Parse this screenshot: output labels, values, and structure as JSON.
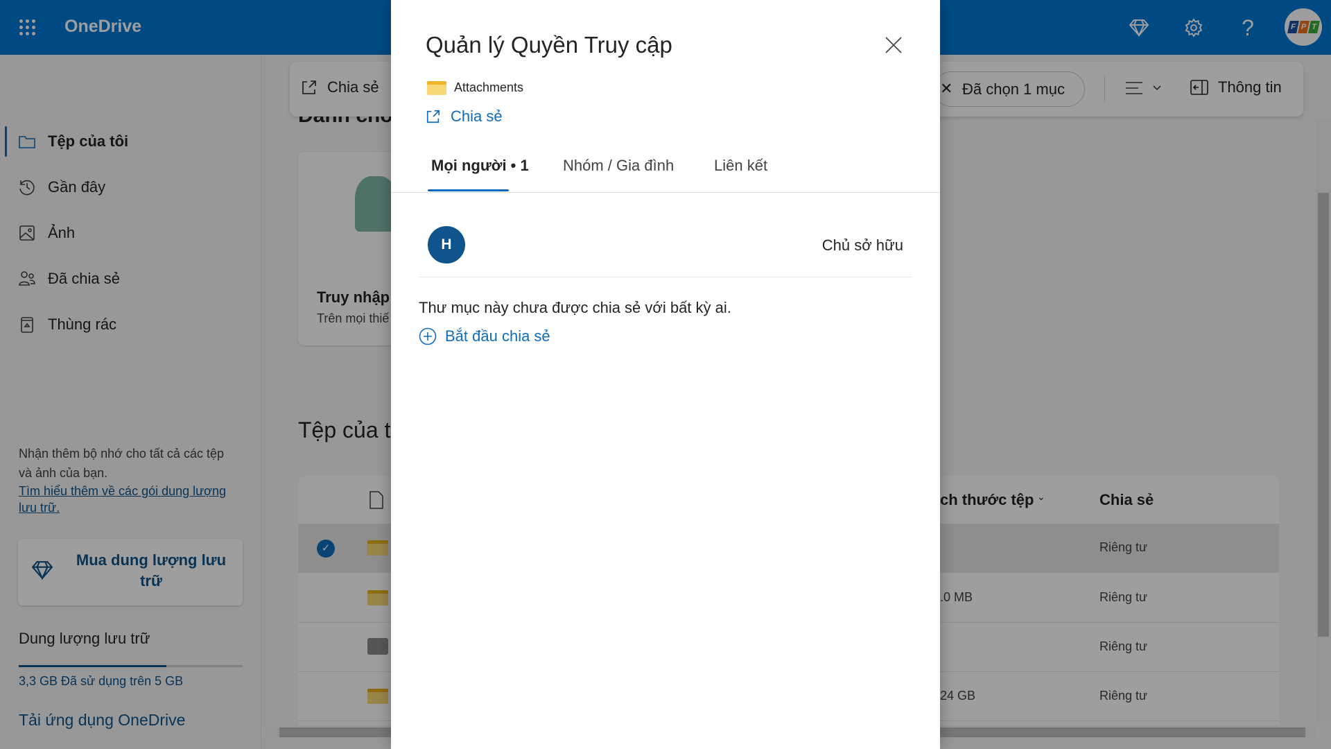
{
  "header": {
    "brand": "OneDrive",
    "icons": [
      "waffle-icon",
      "diamond-icon",
      "gear-icon",
      "help-icon"
    ],
    "avatar_logo": "FPT",
    "accent": "#0078d4"
  },
  "sidebar": {
    "items": [
      {
        "label": "Tệp của tôi",
        "icon": "folder-icon",
        "active": true
      },
      {
        "label": "Gần đây",
        "icon": "history-icon"
      },
      {
        "label": "Ảnh",
        "icon": "image-icon"
      },
      {
        "label": "Đã chia sẻ",
        "icon": "people-icon"
      },
      {
        "label": "Thùng rác",
        "icon": "recycle-bin-icon"
      }
    ],
    "promo_text": "Nhận thêm bộ nhớ cho tất cả các tệp và ảnh của bạn.",
    "promo_link": "Tìm hiểu thêm về các gói dung lượng lưu trữ.",
    "buy_button": "Mua dung lượng lưu trữ",
    "storage_title": "Dung lượng lưu trữ",
    "storage_used_fraction": 0.66,
    "storage_usage": "3,3 GB Đã sử dụng trên 5 GB",
    "get_app": "Tải ứng dụng OneDrive"
  },
  "toolbar": {
    "share": "Chia sẻ",
    "selected": "Đã chọn 1 mục",
    "info": "Thông tin"
  },
  "main": {
    "section1_title": "Danh cho",
    "card_title": "Truy nhập",
    "card_subtitle": "Trên mọi thiế",
    "section2_title": "Tệp của t",
    "columns": {
      "size": "ch thước tệp",
      "sharing": "Chia sẻ"
    },
    "rows": [
      {
        "size": "",
        "sharing": "Riêng tư",
        "selected": true,
        "icon": "folder-icon"
      },
      {
        "size": ".0 MB",
        "sharing": "Riêng tư",
        "icon": "folder-icon"
      },
      {
        "size": "",
        "sharing": "Riêng tư",
        "icon": "vault-icon"
      },
      {
        "size": "24 GB",
        "sharing": "Riêng tư",
        "icon": "folder-icon"
      }
    ]
  },
  "modal": {
    "title": "Quản lý Quyền Truy cập",
    "item_name": "Attachments",
    "share_link": "Chia sẻ",
    "tabs": [
      {
        "label": "Mọi người • 1",
        "active": true
      },
      {
        "label": "Nhóm / Gia đình"
      },
      {
        "label": "Liên kết"
      }
    ],
    "person_initial": "H",
    "person_role": "Chủ sở hữu",
    "message": "Thư mục này chưa được chia sẻ với bất kỳ ai.",
    "start_sharing": "Bắt đầu chia sẻ"
  }
}
